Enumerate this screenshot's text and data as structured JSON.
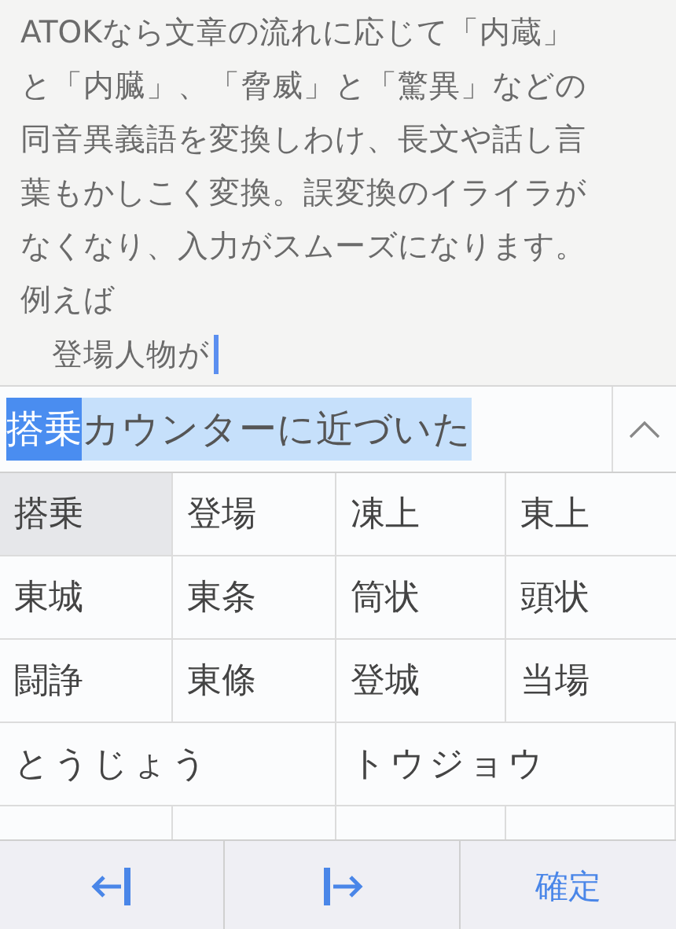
{
  "editor": {
    "lines": [
      "ATOKなら文章の流れに応じて「内蔵」",
      "と「内臓」、「脅威」と「驚異」などの",
      "同音異義語を変換しわけ、長文や話し言",
      "葉もかしこく変換。誤変換のイライラが",
      "なくなり、入力がスムーズになります。",
      "例えば"
    ],
    "current_line": "　登場人物が"
  },
  "composition": {
    "segments": [
      {
        "text": "搭乗",
        "selected": true
      },
      {
        "text": "カウンターに近づいた",
        "selected": false
      }
    ]
  },
  "candidates": [
    {
      "text": "搭乗",
      "selected": true,
      "kind": "word"
    },
    {
      "text": "登場",
      "selected": false,
      "kind": "word"
    },
    {
      "text": "凍上",
      "selected": false,
      "kind": "word"
    },
    {
      "text": "東上",
      "selected": false,
      "kind": "word"
    },
    {
      "text": "東城",
      "selected": false,
      "kind": "word"
    },
    {
      "text": "東条",
      "selected": false,
      "kind": "word"
    },
    {
      "text": "筒状",
      "selected": false,
      "kind": "word"
    },
    {
      "text": "頭状",
      "selected": false,
      "kind": "word"
    },
    {
      "text": "闘諍",
      "selected": false,
      "kind": "word"
    },
    {
      "text": "東條",
      "selected": false,
      "kind": "word"
    },
    {
      "text": "登城",
      "selected": false,
      "kind": "word"
    },
    {
      "text": "当場",
      "selected": false,
      "kind": "word"
    },
    {
      "text": "とうじょう",
      "selected": false,
      "kind": "reading"
    },
    {
      "text": "トウジョウ",
      "selected": false,
      "kind": "reading"
    }
  ],
  "toolbar": [
    {
      "kind": "cursor-left"
    },
    {
      "kind": "cursor-right"
    },
    {
      "kind": "text",
      "label": "確定"
    }
  ]
}
